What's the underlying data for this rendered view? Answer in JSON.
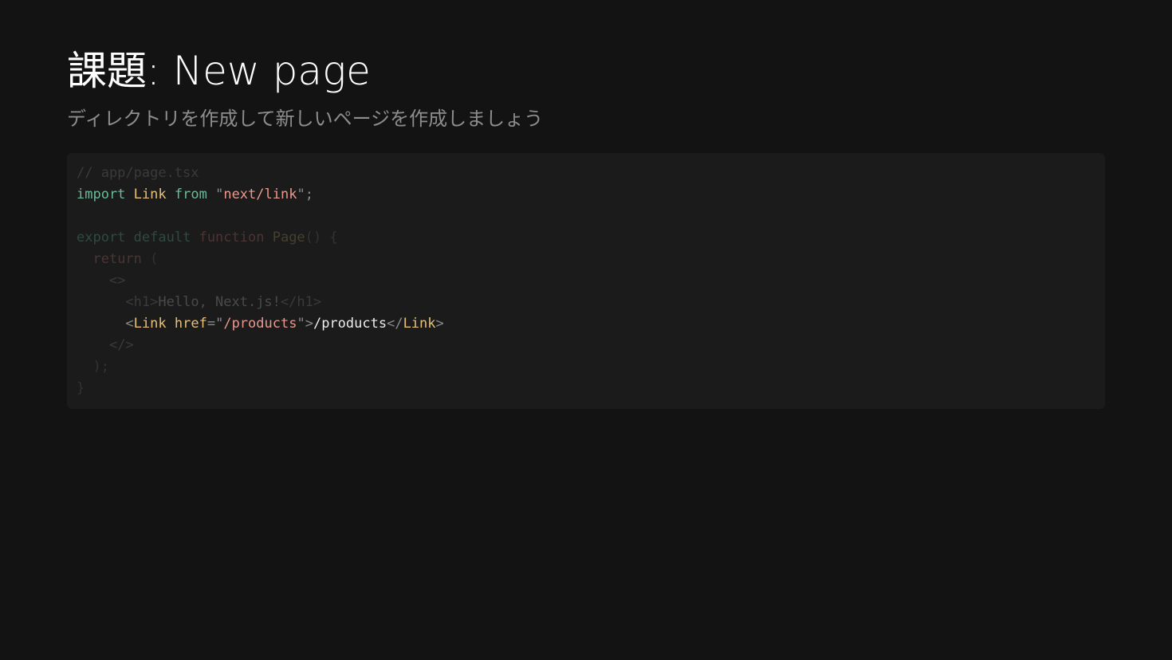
{
  "slide": {
    "title": "課題: New page",
    "subtitle": "ディレクトリを作成して新しいページを作成しましょう"
  },
  "colors": {
    "background": "#131313",
    "code_background": "#1b1b1b",
    "title": "#ffffff",
    "subtitle": "#8d8d8d",
    "keyword": "#6db99a",
    "identifier": "#e6c07b",
    "string": "#e8998d",
    "punctuation": "#8a8a8a",
    "plain": "#ededed",
    "dim_comment": "#3a3a3a",
    "dim_keyword": "#2f4a3f",
    "dim_function": "#4a3534",
    "dim_identifier": "#45402f",
    "dim_punctuation": "#333333",
    "dim_text": "#4a4a4a",
    "dim_tag": "#3a3a3a"
  },
  "code": {
    "lines": [
      {
        "tokens": [
          {
            "t": "// app/page.tsx",
            "c": "dim_comment"
          }
        ]
      },
      {
        "tokens": [
          {
            "t": "import",
            "c": "keyword"
          },
          {
            "t": " ",
            "c": "plain"
          },
          {
            "t": "Link",
            "c": "identifier"
          },
          {
            "t": " ",
            "c": "plain"
          },
          {
            "t": "from",
            "c": "keyword"
          },
          {
            "t": " ",
            "c": "plain"
          },
          {
            "t": "\"",
            "c": "punctuation"
          },
          {
            "t": "next/link",
            "c": "string"
          },
          {
            "t": "\"",
            "c": "punctuation"
          },
          {
            "t": ";",
            "c": "punctuation"
          }
        ]
      },
      {
        "tokens": []
      },
      {
        "tokens": [
          {
            "t": "export",
            "c": "dim_keyword"
          },
          {
            "t": " ",
            "c": "plain"
          },
          {
            "t": "default",
            "c": "dim_keyword"
          },
          {
            "t": " ",
            "c": "plain"
          },
          {
            "t": "function",
            "c": "dim_function"
          },
          {
            "t": " ",
            "c": "plain"
          },
          {
            "t": "Page",
            "c": "dim_identifier"
          },
          {
            "t": "() {",
            "c": "dim_punctuation"
          }
        ]
      },
      {
        "tokens": [
          {
            "t": "  ",
            "c": "plain"
          },
          {
            "t": "return",
            "c": "dim_function"
          },
          {
            "t": " (",
            "c": "dim_punctuation"
          }
        ]
      },
      {
        "tokens": [
          {
            "t": "    ",
            "c": "plain"
          },
          {
            "t": "<>",
            "c": "dim_tag"
          }
        ]
      },
      {
        "tokens": [
          {
            "t": "      ",
            "c": "plain"
          },
          {
            "t": "<h1>",
            "c": "dim_tag"
          },
          {
            "t": "Hello, Next.js!",
            "c": "dim_text"
          },
          {
            "t": "</h1>",
            "c": "dim_tag"
          }
        ]
      },
      {
        "tokens": [
          {
            "t": "      ",
            "c": "plain"
          },
          {
            "t": "<",
            "c": "punctuation"
          },
          {
            "t": "Link",
            "c": "identifier"
          },
          {
            "t": " ",
            "c": "plain"
          },
          {
            "t": "href",
            "c": "identifier"
          },
          {
            "t": "=",
            "c": "punctuation"
          },
          {
            "t": "\"",
            "c": "punctuation"
          },
          {
            "t": "/products",
            "c": "string"
          },
          {
            "t": "\"",
            "c": "punctuation"
          },
          {
            "t": ">",
            "c": "punctuation"
          },
          {
            "t": "/products",
            "c": "plain"
          },
          {
            "t": "</",
            "c": "punctuation"
          },
          {
            "t": "Link",
            "c": "identifier"
          },
          {
            "t": ">",
            "c": "punctuation"
          }
        ]
      },
      {
        "tokens": [
          {
            "t": "    ",
            "c": "plain"
          },
          {
            "t": "</>",
            "c": "dim_tag"
          }
        ]
      },
      {
        "tokens": [
          {
            "t": "  ",
            "c": "plain"
          },
          {
            "t": ");",
            "c": "dim_punctuation"
          }
        ]
      },
      {
        "tokens": [
          {
            "t": "}",
            "c": "dim_punctuation"
          }
        ]
      }
    ]
  }
}
